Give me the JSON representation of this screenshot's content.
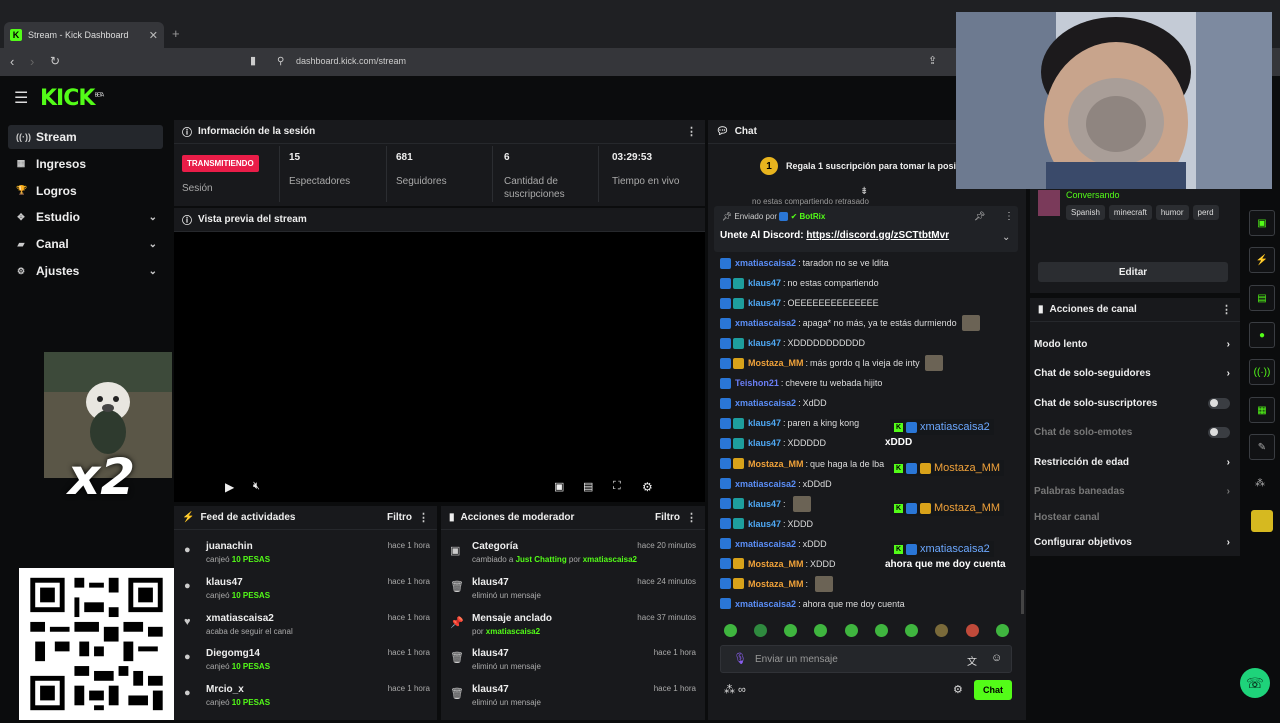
{
  "browser": {
    "tab_title": "Stream - Kick Dashboard",
    "tab_favicon": "K",
    "url": "dashboard.kick.com/stream"
  },
  "brand": {
    "logo": "KICK",
    "logo_suffix": "BETA",
    "accent": "#53fc18"
  },
  "sidebar": {
    "items": [
      {
        "label": "Stream",
        "icon": "broadcast-icon",
        "glyph": "((·))",
        "active": true,
        "chevron": false
      },
      {
        "label": "Ingresos",
        "icon": "money-icon",
        "glyph": "▦",
        "active": false,
        "chevron": false
      },
      {
        "label": "Logros",
        "icon": "trophy-icon",
        "glyph": "🏆",
        "active": false,
        "chevron": false
      },
      {
        "label": "Estudio",
        "icon": "studio-icon",
        "glyph": "✥",
        "active": false,
        "chevron": true
      },
      {
        "label": "Canal",
        "icon": "channel-icon",
        "glyph": "▰",
        "active": false,
        "chevron": true
      },
      {
        "label": "Ajustes",
        "icon": "gear-icon",
        "glyph": "⚙",
        "active": false,
        "chevron": true
      }
    ]
  },
  "overlay": {
    "multiplier": "x2"
  },
  "session": {
    "title": "Información de la sesión",
    "live_badge": "TRANSMITIENDO",
    "live_label": "Sesión",
    "stats": [
      {
        "value": "15",
        "label": "Espectadores"
      },
      {
        "value": "681",
        "label": "Seguidores"
      },
      {
        "value": "6",
        "label": "Cantidad de suscripciones"
      },
      {
        "value": "03:29:53",
        "label": "Tiempo en vivo"
      }
    ]
  },
  "preview": {
    "title": "Vista previa del stream"
  },
  "feed": {
    "title": "Feed de actividades",
    "filter": "Filtro",
    "items": [
      {
        "user": "juanachin",
        "pre": "canjeó ",
        "hl": "10 PESAS",
        "time": "hace 1 hora",
        "glyph": "●"
      },
      {
        "user": "klaus47",
        "pre": "canjeó ",
        "hl": "10 PESAS",
        "time": "hace 1 hora",
        "glyph": "●"
      },
      {
        "user": "xmatiascaisa2",
        "pre": "acaba de seguir el canal",
        "hl": "",
        "time": "hace 1 hora",
        "glyph": "♥"
      },
      {
        "user": "Diegomg14",
        "pre": "canjeó ",
        "hl": "10 PESAS",
        "time": "hace 1 hora",
        "glyph": "●"
      },
      {
        "user": "Mrcio_x",
        "pre": "canjeó ",
        "hl": "10 PESAS",
        "time": "hace 1 hora",
        "glyph": "●"
      }
    ]
  },
  "mod": {
    "title": "Acciones de moderador",
    "filter": "Filtro",
    "items": [
      {
        "title": "Categoría",
        "pre": "cambiado a ",
        "hl": "Just Chatting",
        "mid": " por ",
        "hl2": "xmatiascaisa2",
        "time": "hace 20 minutos",
        "glyph": "▣"
      },
      {
        "title": "klaus47",
        "pre": "eliminó un mensaje",
        "hl": "",
        "mid": "",
        "hl2": "",
        "time": "hace 24 minutos",
        "glyph": "🗑"
      },
      {
        "title": "Mensaje anclado",
        "pre": "por ",
        "hl": "xmatiascaisa2",
        "mid": "",
        "hl2": "",
        "time": "hace 37 minutos",
        "glyph": "📌"
      },
      {
        "title": "klaus47",
        "pre": "eliminó un mensaje",
        "hl": "",
        "mid": "",
        "hl2": "",
        "time": "hace 1 hora",
        "glyph": "🗑"
      },
      {
        "title": "klaus47",
        "pre": "eliminó un mensaje",
        "hl": "",
        "mid": "",
        "hl2": "",
        "time": "hace 1 hora",
        "glyph": "🗑"
      }
    ]
  },
  "chat": {
    "title": "Chat",
    "sub_goal_rank": "1",
    "sub_goal": "Regala 1 suscripción para tomar la posici",
    "scroll_hint": "no estas compartiendo retrasado",
    "pinned_by_label": "Enviado por",
    "pinned_by": "BotRix",
    "pinned_text": "Unete Al Discord: ",
    "pinned_link": "https://discord.gg/zSCTtbtMvr",
    "messages": [
      {
        "user": "xmatiascaisa2",
        "text": "taradon no se ve ldita",
        "color": "c1",
        "badges": [
          "blue"
        ],
        "emote": false
      },
      {
        "user": "klaus47",
        "text": "no estas compartiendo",
        "color": "c2",
        "badges": [
          "blue",
          "teal"
        ],
        "emote": false
      },
      {
        "user": "klaus47",
        "text": "OEEEEEEEEEEEEEE",
        "color": "c2",
        "badges": [
          "blue",
          "teal"
        ],
        "emote": false
      },
      {
        "user": "xmatiascaisa2",
        "text": "apaga* no más, ya te estás durmiendo",
        "color": "c1",
        "badges": [
          "blue"
        ],
        "emote": true
      },
      {
        "user": "klaus47",
        "text": "XDDDDDDDDDDD",
        "color": "c2",
        "badges": [
          "blue",
          "teal"
        ],
        "emote": false
      },
      {
        "user": "Mostaza_MM",
        "text": "más gordo q la vieja de inty",
        "color": "c3",
        "badges": [
          "blue",
          "gold"
        ],
        "emote": true
      },
      {
        "user": "Teishon21",
        "text": "chevere tu webada hijito",
        "color": "c4",
        "badges": [
          "blue"
        ],
        "emote": false
      },
      {
        "user": "xmatiascaisa2",
        "text": "XdDD",
        "color": "c1",
        "badges": [
          "blue"
        ],
        "emote": false
      },
      {
        "user": "klaus47",
        "text": "paren a king kong",
        "color": "c2",
        "badges": [
          "blue",
          "teal"
        ],
        "emote": false
      },
      {
        "user": "klaus47",
        "text": "XDDDDD",
        "color": "c2",
        "badges": [
          "blue",
          "teal"
        ],
        "emote": false
      },
      {
        "user": "Mostaza_MM",
        "text": "que haga la de lba",
        "color": "c3",
        "badges": [
          "blue",
          "gold"
        ],
        "emote": false
      },
      {
        "user": "xmatiascaisa2",
        "text": "xDDdD",
        "color": "c1",
        "badges": [
          "blue"
        ],
        "emote": false
      },
      {
        "user": "klaus47",
        "text": "",
        "color": "c2",
        "badges": [
          "blue",
          "teal"
        ],
        "emote": true
      },
      {
        "user": "klaus47",
        "text": "XDDD",
        "color": "c2",
        "badges": [
          "blue",
          "teal"
        ],
        "emote": false
      },
      {
        "user": "xmatiascaisa2",
        "text": "xDDD",
        "color": "c1",
        "badges": [
          "blue"
        ],
        "emote": false
      },
      {
        "user": "Mostaza_MM",
        "text": "XDDD",
        "color": "c3",
        "badges": [
          "blue",
          "gold"
        ],
        "emote": false
      },
      {
        "user": "Mostaza_MM",
        "text": "",
        "color": "c3",
        "badges": [
          "blue",
          "gold"
        ],
        "emote": true
      },
      {
        "user": "xmatiascaisa2",
        "text": "ahora que me doy cuenta",
        "color": "c1",
        "badges": [
          "blue"
        ],
        "emote": false
      }
    ],
    "input_placeholder": "Enviar un mensaje",
    "send_label": "Chat"
  },
  "stream_overlay_chat": [
    {
      "user": "xmatiascaisa2",
      "msg": "xDDD",
      "orange": false
    },
    {
      "user": "Mostaza_MM",
      "msg": "",
      "orange": true
    },
    {
      "user": "Mostaza_MM",
      "msg": "",
      "orange": true
    },
    {
      "user": "xmatiascaisa2",
      "msg": "ahora que me doy cuenta",
      "orange": false
    }
  ],
  "stream_info": {
    "status": "Conversando",
    "tags": [
      "Spanish",
      "minecraft",
      "humor",
      "perd"
    ],
    "edit_label": "Editar"
  },
  "channel_actions": {
    "title": "Acciones de canal",
    "items": [
      {
        "label": "Modo lento",
        "kind": "chevron",
        "dim": false
      },
      {
        "label": "Chat de solo-seguidores",
        "kind": "chevron",
        "dim": false
      },
      {
        "label": "Chat de solo-suscriptores",
        "kind": "toggle",
        "dim": false
      },
      {
        "label": "Chat de solo-emotes",
        "kind": "toggle",
        "dim": true
      },
      {
        "label": "Restricción de edad",
        "kind": "chevron",
        "dim": false
      },
      {
        "label": "Palabras baneadas",
        "kind": "chevron",
        "dim": true
      },
      {
        "label": "Hostear canal",
        "kind": "none",
        "dim": true
      },
      {
        "label": "Configurar objetivos",
        "kind": "chevron",
        "dim": false
      }
    ]
  }
}
